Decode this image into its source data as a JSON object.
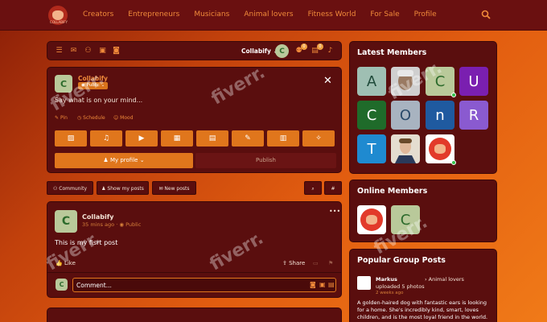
{
  "nav": {
    "logo_text": "COLLABIFY",
    "links": [
      "Creators",
      "Entrepreneurs",
      "Musicians",
      "Animal lovers",
      "Fitness World",
      "For Sale",
      "Profile"
    ]
  },
  "toolbar": {
    "account": "Collabify",
    "avatar_letter": "C",
    "badge_friends": "0",
    "badge_messages": "0"
  },
  "composer": {
    "avatar_letter": "C",
    "name": "Collabify",
    "privacy": "Public",
    "placeholder": "Say what is on your mind...",
    "options": [
      "Pin",
      "Schedule",
      "Mood"
    ],
    "profile_button": "My profile",
    "publish_button": "Publish"
  },
  "filters": {
    "community": "Community",
    "my_posts": "Show my posts",
    "new_posts": "New posts"
  },
  "post": {
    "avatar_letter": "C",
    "author": "Collabify",
    "time": "35 mins ago",
    "privacy": "Public",
    "text": "This is my fisrt post",
    "like": "Like",
    "share": "Share",
    "comment_placeholder": "Comment..."
  },
  "latest_members": {
    "title": "Latest Members",
    "tiles": [
      {
        "letter": "A",
        "color": "#9fbfb3"
      },
      {
        "letter": "",
        "color": "#c9c9c9"
      },
      {
        "letter": "C",
        "color": "#b9c99a"
      },
      {
        "letter": "U",
        "color": "#7a1fb0"
      },
      {
        "letter": "C",
        "color": "#1f6b2a"
      },
      {
        "letter": "O",
        "color": "#a8b3c0"
      },
      {
        "letter": "n",
        "color": "#1f5aa0"
      },
      {
        "letter": "R",
        "color": "#8a5ad0"
      },
      {
        "letter": "T",
        "color": "#1f8ad0"
      },
      {
        "letter": "",
        "color": "#d9d0c0"
      },
      {
        "letter": "",
        "color": "#ffffff"
      }
    ]
  },
  "online_members": {
    "title": "Online Members",
    "letter": "C"
  },
  "group_posts": {
    "title": "Popular Group Posts",
    "author": "Markus",
    "group": "Animal lovers",
    "action": "uploaded 5 photos",
    "time": "2 weeks ago",
    "body": "A golden-haired dog with fantastic ears is looking for a home. She's incredibly kind, smart, loves children, and is the most loyal friend in the world."
  },
  "watermark": "fiverr."
}
